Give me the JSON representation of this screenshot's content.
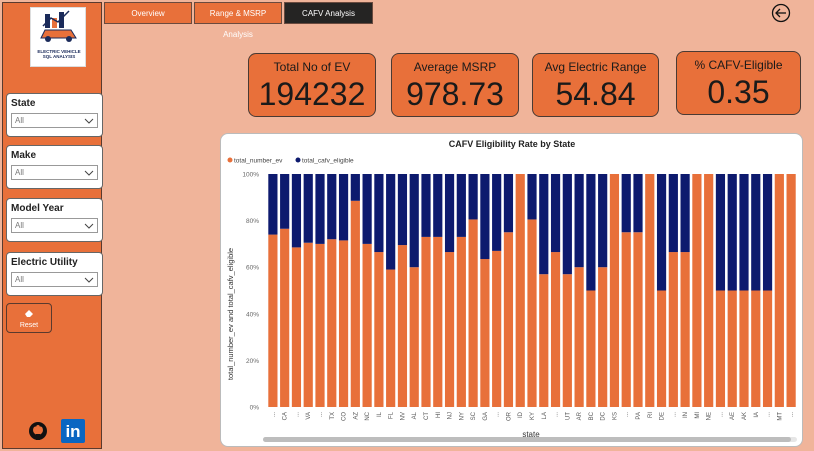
{
  "tabs": [
    "Overview",
    "Range & MSRP Analysis",
    "CAFV Analysis"
  ],
  "logo": {
    "line1": "ELECTRIC VEHICLE",
    "line2": "SQL ANALYSIS"
  },
  "slicers": [
    {
      "label": "State",
      "value": "All"
    },
    {
      "label": "Make",
      "value": "All"
    },
    {
      "label": "Model Year",
      "value": "All"
    },
    {
      "label": "Electric Utility",
      "value": "All"
    }
  ],
  "reset_label": "Reset",
  "kpis": [
    {
      "title": "Total No of EV",
      "value": "194232"
    },
    {
      "title": "Average MSRP",
      "value": "978.73"
    },
    {
      "title": "Avg Electric Range",
      "value": "54.84"
    },
    {
      "title": "% CAFV-Eligible",
      "value": "0.35"
    }
  ],
  "icons": {
    "back": "back-arrow-icon",
    "github": "github-icon",
    "linkedin": "linkedin-icon",
    "reset": "eraser-icon",
    "dropdown": "chevron-down-icon"
  },
  "colors": {
    "orange": "#e8703a",
    "navy": "#0d1a6e",
    "background": "#f0b49a"
  },
  "chart_data": {
    "type": "bar",
    "stacked": "100%",
    "title": "CAFV Eligibility Rate by State",
    "xlabel": "state",
    "ylabel": "total_number_ev and total_cafv_eligible",
    "ylim": [
      0,
      100
    ],
    "yticks": [
      "0%",
      "20%",
      "40%",
      "60%",
      "80%",
      "100%"
    ],
    "legend_position": "top-left",
    "categories": [
      "",
      "CA",
      "",
      "VA",
      "",
      "TX",
      "CO",
      "AZ",
      "NC",
      "IL",
      "FL",
      "NV",
      "AL",
      "CT",
      "HI",
      "NJ",
      "NY",
      "SC",
      "GA",
      "",
      "OR",
      "ID",
      "KY",
      "LA",
      "",
      "UT",
      "AR",
      "BC",
      "DC",
      "KS",
      "",
      "PA",
      "RI",
      "DE",
      "",
      "IN",
      "MI",
      "NE",
      "",
      "AE",
      "AK",
      "IA",
      "",
      "MT",
      ""
    ],
    "series": [
      {
        "name": "total_number_ev",
        "color": "#e8703a",
        "values": [
          74,
          76.5,
          68.5,
          70.5,
          70,
          72,
          71.5,
          88.5,
          70,
          66.5,
          59,
          69.5,
          60,
          73,
          73,
          66.5,
          73,
          80.5,
          63.5,
          67,
          75,
          100,
          80.5,
          57,
          66.5,
          57,
          60,
          50,
          60,
          100,
          75,
          75,
          100,
          50,
          66.5,
          66.5,
          100,
          100,
          50,
          50,
          50,
          50,
          50,
          100,
          100
        ]
      },
      {
        "name": "total_cafv_eligible",
        "color": "#0d1a6e",
        "values": [
          26,
          23.5,
          31.5,
          29.5,
          30,
          28,
          28.5,
          11.5,
          30,
          33.5,
          41,
          30.5,
          40,
          27,
          27,
          33.5,
          27,
          19.5,
          36.5,
          33,
          25,
          0,
          19.5,
          43,
          33.5,
          43,
          40,
          50,
          40,
          0,
          25,
          25,
          0,
          50,
          33.5,
          33.5,
          0,
          0,
          50,
          50,
          50,
          50,
          50,
          0,
          0
        ]
      }
    ]
  }
}
